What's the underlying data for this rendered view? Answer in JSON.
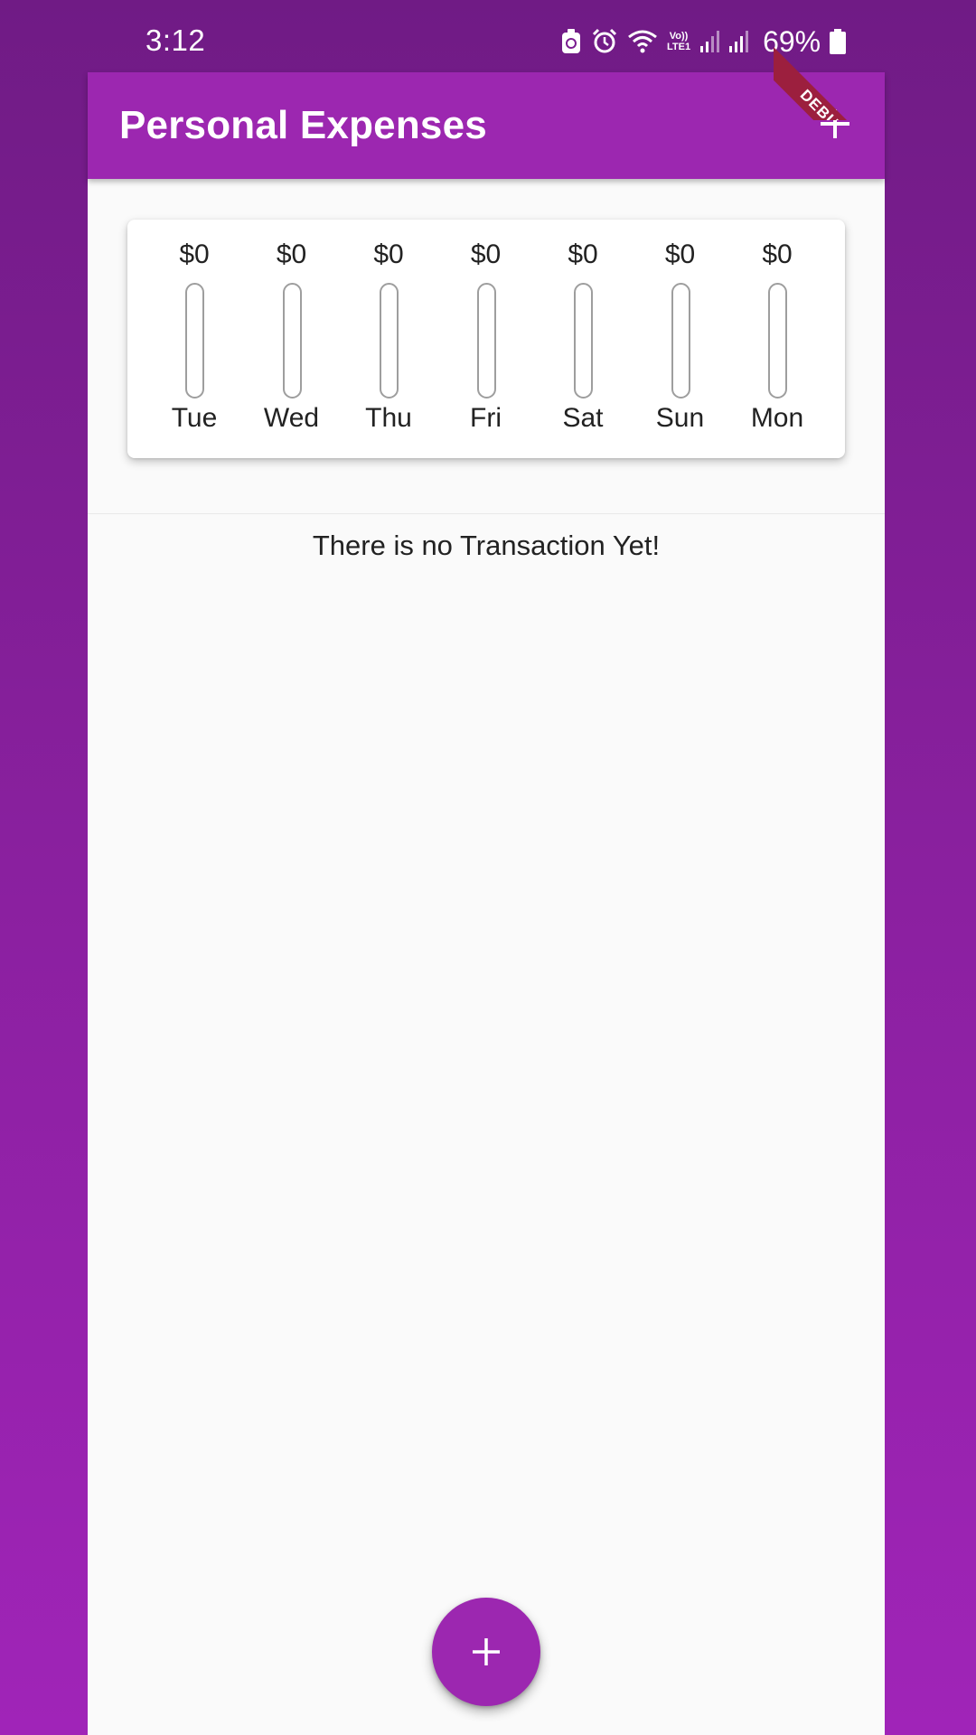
{
  "status_bar": {
    "time": "3:12",
    "volte_line1": "Vo))",
    "volte_line2": "LTE1",
    "battery_percent": "69%"
  },
  "debug_banner": {
    "label": "DEBUG"
  },
  "app_bar": {
    "title": "Personal Expenses",
    "add_icon": "plus-icon"
  },
  "colors": {
    "primary": "#9c27b0",
    "background_gradient_top": "#701b85",
    "background_gradient_bottom": "#a024b8",
    "debug_ribbon": "#9c1f3e"
  },
  "chart_data": {
    "type": "bar",
    "categories": [
      "Tue",
      "Wed",
      "Thu",
      "Fri",
      "Sat",
      "Sun",
      "Mon"
    ],
    "labels": [
      "$0",
      "$0",
      "$0",
      "$0",
      "$0",
      "$0",
      "$0"
    ],
    "values": [
      0,
      0,
      0,
      0,
      0,
      0,
      0
    ],
    "fill_fraction": [
      0,
      0,
      0,
      0,
      0,
      0,
      0
    ]
  },
  "transactions": {
    "empty_message": "There is no Transaction Yet!"
  },
  "fab": {
    "icon": "plus-icon"
  }
}
